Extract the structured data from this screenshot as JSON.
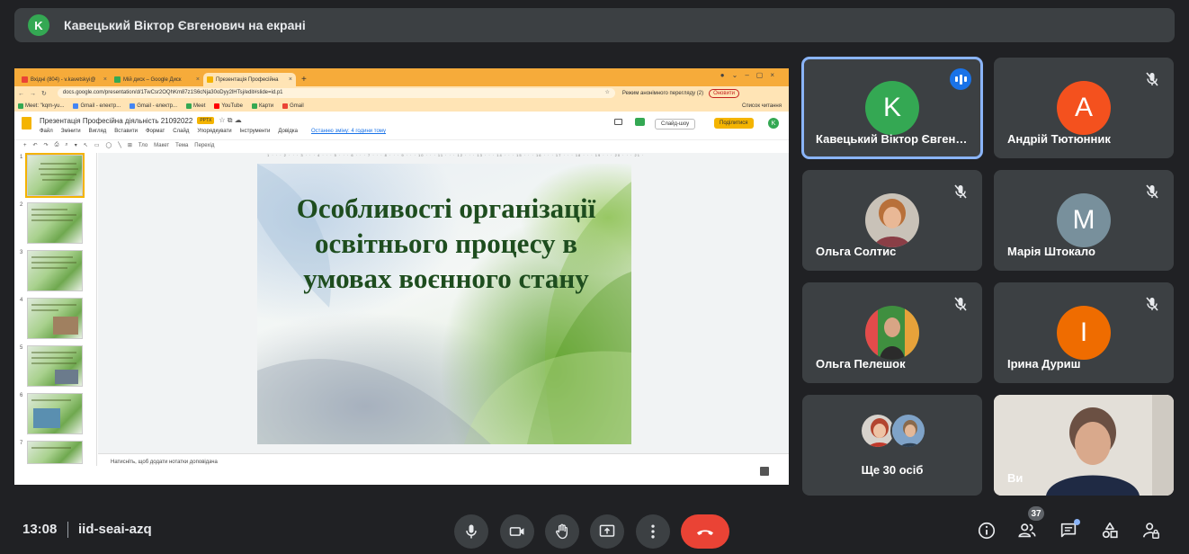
{
  "banner": {
    "avatar_letter": "K",
    "avatar_color": "#34a853",
    "text": "Кавецький Віктор Євгенович на екрані"
  },
  "browser": {
    "tabs": [
      {
        "label": "Вхідні (804) - v.kavetskyi@",
        "icon": "gmail-icon",
        "color": "#ea4335"
      },
      {
        "label": "Мій диск – Google Диск",
        "icon": "drive-icon",
        "color": "#34a853"
      },
      {
        "label": "Презентація Професійна",
        "icon": "slides-icon",
        "color": "#f4b400"
      }
    ],
    "new_tab": "+",
    "url": "docs.google.com/presentation/d/1TwCsr2OQhKm87z1S6cNja30oDyy2lHTsj/edit#slide=id.p1",
    "incognito_label": "Режим анонімного перегляду (2)",
    "refresh_label": "Оновити",
    "bookmarks": [
      {
        "label": "Meet: \"kqm-yu...",
        "color": "#34a853"
      },
      {
        "label": "Gmail - електр...",
        "color": "#4285f4"
      },
      {
        "label": "Gmail - електр...",
        "color": "#4285f4"
      },
      {
        "label": "Meet",
        "color": "#34a853"
      },
      {
        "label": "YouTube",
        "color": "#ff0000"
      },
      {
        "label": "Карти",
        "color": "#34a853"
      },
      {
        "label": "Gmail",
        "color": "#ea4335"
      }
    ],
    "reading_list": "Список читання"
  },
  "slides_app": {
    "title": "Презентація Професійна діяльність 21092022",
    "file_badge": "PPTX",
    "menu": [
      "Файл",
      "Змінити",
      "Вигляд",
      "Вставити",
      "Формат",
      "Слайд",
      "Упорядкувати",
      "Інструменти",
      "Довідка"
    ],
    "last_edit": "Останню зміну: 4 години тому",
    "slideshow_label": "Слайд-шоу",
    "share_label": "Поділитися",
    "account_letter": "K",
    "toolbar": [
      "+",
      "↶",
      "↷",
      "⎙",
      "⌕",
      "▾",
      "↖",
      "▭",
      "◯",
      "╲",
      "⊞",
      "Тло",
      "Макет",
      "Тема",
      "Перехід"
    ],
    "ruler": "1 · · · 2 · · · 3 · · · 4 · · · 5 · · · 6 · · · 7 · · · 8 · · · 9 · · · 10 · · · 11 · · · 12 · · · 13 · · · 14 · · · 15 · · · 16 · · · 17 · · · 18 · · · 19 · · · 20 · · · 21 · · · 22 · · · 23 · · · 24 · · · 25",
    "thumbnails": [
      "1",
      "2",
      "3",
      "4",
      "5",
      "6",
      "7"
    ],
    "slide_title": "Особливості організації освітнього процесу в умовах воєнного стану",
    "speaker_notes_placeholder": "Натисніть, щоб додати нотатки доповідача"
  },
  "participants": [
    {
      "name": "Кавецький Віктор Євгенович",
      "letter": "K",
      "color": "#34a853",
      "speaking": true
    },
    {
      "name": "Андрій Тютюнник",
      "letter": "A",
      "color": "#f4511e",
      "muted": true
    },
    {
      "name": "Ольга Солтис",
      "photo": true,
      "muted": true
    },
    {
      "name": "Марія Штокало",
      "letter": "M",
      "color": "#78909c",
      "muted": true
    },
    {
      "name": "Ольга Пелешок",
      "photo": true,
      "muted": true
    },
    {
      "name": "Ірина Дуриш",
      "letter": "I",
      "color": "#ef6c00",
      "muted": true
    }
  ],
  "more_participants": {
    "label": "Ще 30 осіб"
  },
  "self_view": {
    "label": "Ви"
  },
  "bottom_bar": {
    "time": "13:08",
    "meeting_code": "iid-seai-azq",
    "people_count": "37"
  }
}
